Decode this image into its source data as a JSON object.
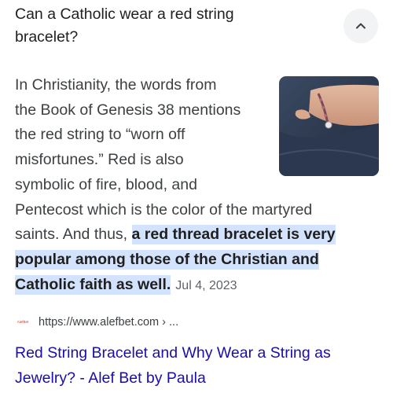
{
  "question": {
    "line1": "Can a Catholic wear a red string",
    "line2": "bracelet?"
  },
  "collapse_icon": "chevron-up-icon",
  "thumbnail_icon": "wrist-bracelet-photo",
  "answer": {
    "line1": "In Christianity, the words from",
    "line2": "the Book of Genesis 38 mentions",
    "line3": "the red string to “worn off",
    "line4": "misfortunes.” Red is also",
    "line5": "symbolic of fire, blood, and",
    "line6": "Pentecost which is the color of the martyred",
    "line7_plain": "saints. And thus, ",
    "line7_highlight": "a red thread bracelet is very",
    "line8_highlight": "popular among those of the Christian and",
    "line9_highlight": "Catholic faith as well.",
    "date": "Jul 4, 2023"
  },
  "source": {
    "favicon_text": "AlefBet",
    "url": "https://www.alefbet.com › ..."
  },
  "result": {
    "title_line1": "Red String Bracelet and Why Wear a String as",
    "title_line2": "Jewelry? - Alef Bet by Paula"
  },
  "colors": {
    "highlight": "#d3e3fd",
    "link": "#1a0dab",
    "text": "#3c4043"
  }
}
